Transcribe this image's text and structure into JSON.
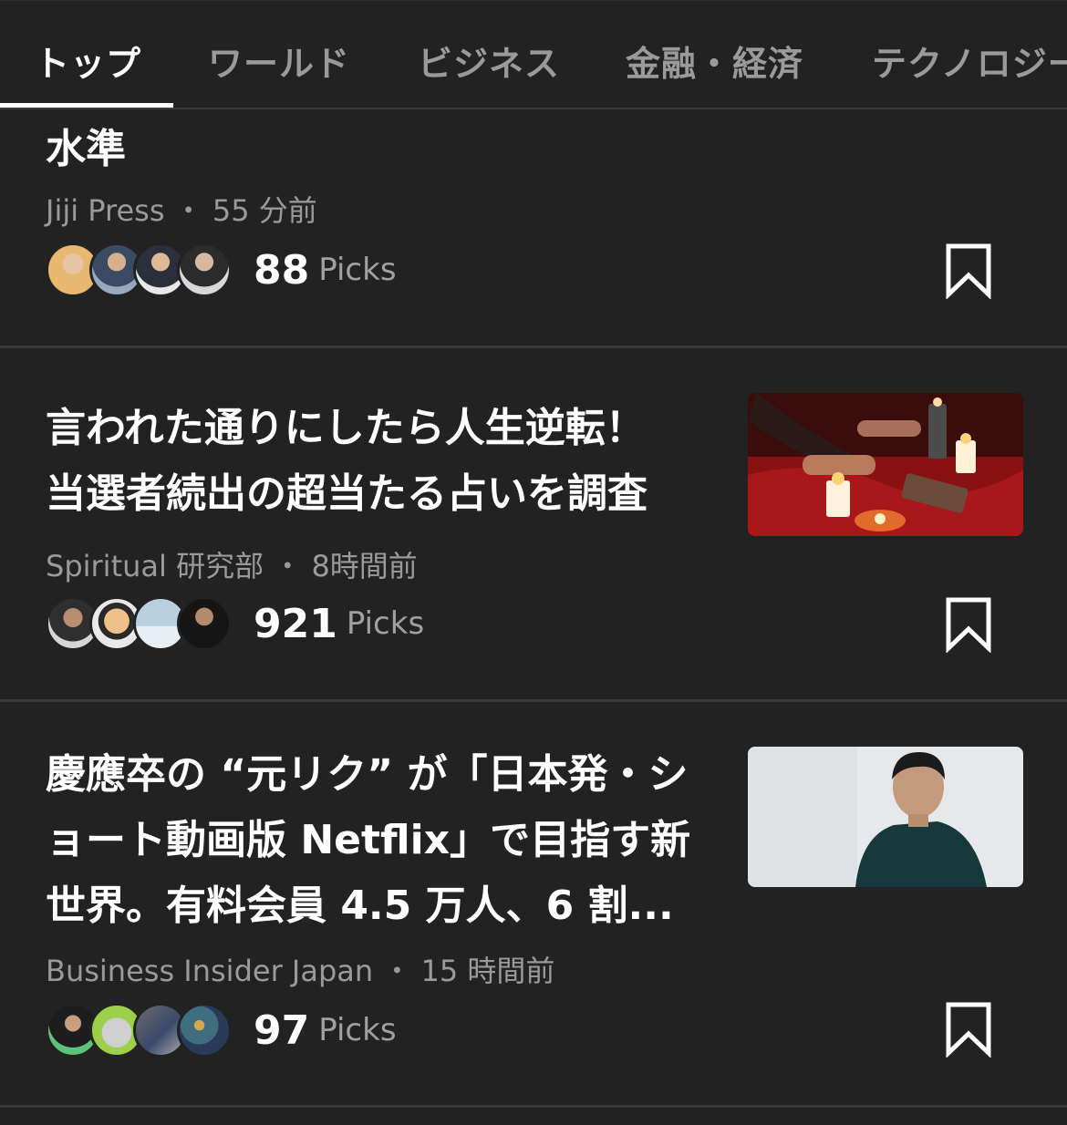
{
  "tabs": [
    "トップ",
    "ワールド",
    "ビジネス",
    "金融・経済",
    "テクノロジー"
  ],
  "articles": [
    {
      "title_lines": [
        "水準"
      ],
      "source": "Jiji Press",
      "time": "55 分前",
      "picks": "88",
      "picks_label": "Picks"
    },
    {
      "title_lines": [
        "言われた通りにしたら人生逆転！",
        "当選者続出の超当たる占いを調査"
      ],
      "source": "Spiritual 研究部",
      "time": "8時間前",
      "picks": "921",
      "picks_label": "Picks",
      "thumb": "fortune-cards-candles-image"
    },
    {
      "title_lines": [
        "慶應卒の “元リク” が「日本発・シ",
        "ョート動画版 Netflix」で目指す新",
        "世界。有料会員 4.5 万人、6 割..."
      ],
      "source": "Business Insider Japan",
      "time": "15 時間前",
      "picks": "97",
      "picks_label": "Picks",
      "thumb": "man-portrait-image"
    }
  ],
  "meta_separator": "・",
  "colors": {
    "background": "#222222",
    "divider": "#3a3a3a",
    "secondary_text": "#9a9a9a"
  }
}
